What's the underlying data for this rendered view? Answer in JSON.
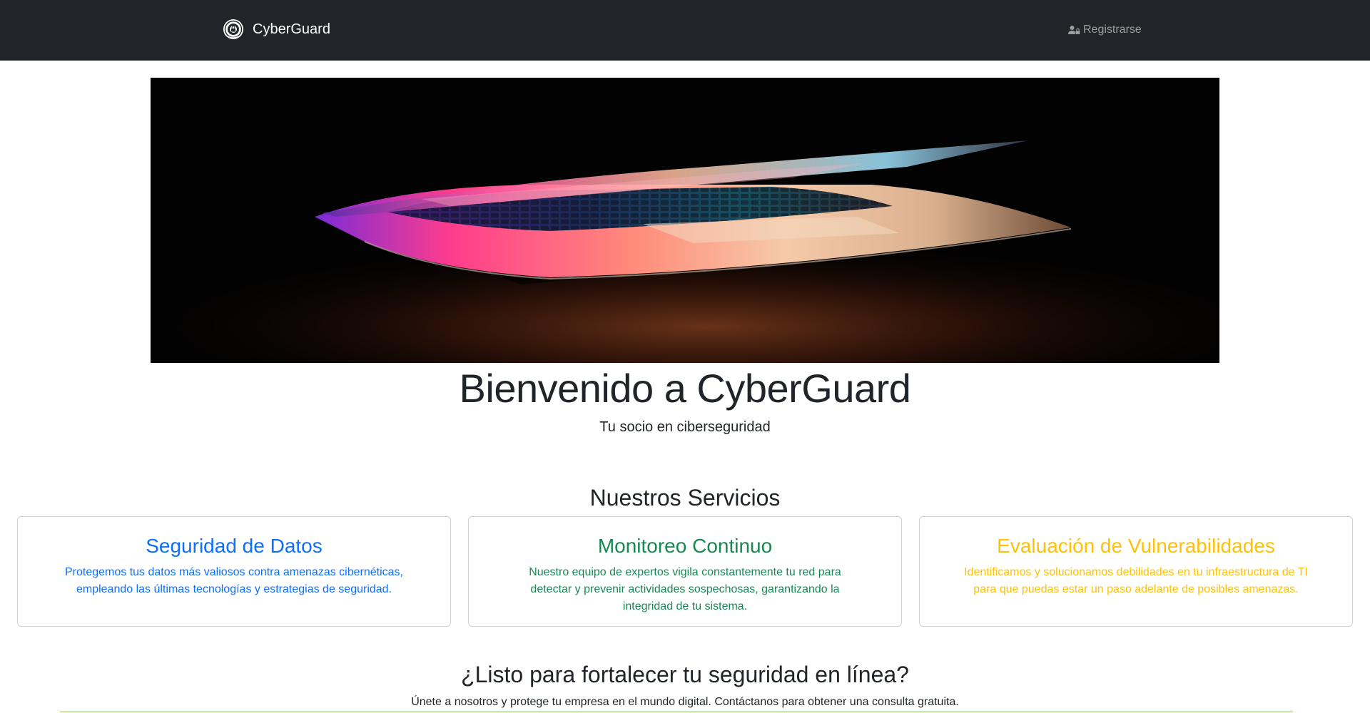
{
  "navbar": {
    "brand_name": "CyberGuard",
    "logo_icon": "shield-lock-logo-icon",
    "register_label": "Registrarse",
    "register_icon": "person-lock-icon",
    "background_color": "#212529"
  },
  "hero": {
    "image": "laptop-open-dark-keyboard-photo"
  },
  "welcome": {
    "title": "Bienvenido a CyberGuard",
    "subtitle": "Tu socio en ciberseguridad"
  },
  "services": {
    "title": "Nuestros Servicios",
    "cards": [
      {
        "title": "Seguridad de Datos",
        "text": "Protegemos tus datos más valiosos contra amenazas cibernéticas, empleando las últimas tecnologías y estrategias de seguridad.",
        "color": "#0d6efd"
      },
      {
        "title": "Monitoreo Continuo",
        "text": "Nuestro equipo de expertos vigila constantemente tu red para detectar y prevenir actividades sospechosas, garantizando la integridad de tu sistema.",
        "color": "#198754"
      },
      {
        "title": "Evaluación de Vulnerabilidades",
        "text": "Identificamos y solucionamos debilidades en tu infraestructura de TI para que puedas estar un paso adelante de posibles amenazas.",
        "color": "#ffc107"
      }
    ]
  },
  "cta": {
    "title": "¿Listo para fortalecer tu seguridad en línea?",
    "text": "Únete a nosotros y protege tu empresa en el mundo digital. Contáctanos para obtener una consulta gratuita."
  }
}
